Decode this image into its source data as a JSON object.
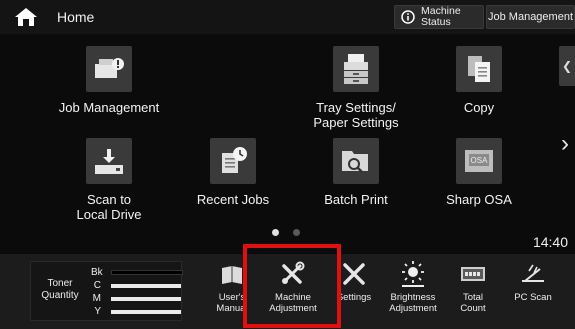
{
  "header": {
    "title": "Home",
    "machine_status": "Machine\nStatus",
    "job_management": "Job Management"
  },
  "apps": [
    {
      "label": "Job Management",
      "icon": "job-management-icon"
    },
    {
      "label": "Tray Settings/\nPaper Settings",
      "icon": "tray-settings-icon"
    },
    {
      "label": "Copy",
      "icon": "copy-icon"
    },
    {
      "label": "Scan to\nLocal Drive",
      "icon": "scan-to-local-drive-icon"
    },
    {
      "label": "Recent Jobs",
      "icon": "recent-jobs-icon"
    },
    {
      "label": "Batch Print",
      "icon": "batch-print-icon"
    },
    {
      "label": "Sharp OSA",
      "icon": "sharp-osa-icon"
    }
  ],
  "clock": "14:40",
  "toner": {
    "label": "Toner\nQuantity",
    "channels": [
      "Bk",
      "C",
      "M",
      "Y"
    ]
  },
  "bottom_items": [
    {
      "label": "User's\nManual",
      "icon": "manual-icon"
    },
    {
      "label": "Machine\nAdjustment",
      "icon": "machine-adjustment-icon"
    },
    {
      "label": "Settings",
      "icon": "settings-icon"
    },
    {
      "label": "Brightness\nAdjustment",
      "icon": "brightness-icon"
    },
    {
      "label": "Total\nCount",
      "icon": "total-count-icon"
    },
    {
      "label": "PC Scan",
      "icon": "pc-scan-icon"
    }
  ],
  "colors": {
    "background": "#0e0e0e",
    "highlight": "#e01010"
  }
}
